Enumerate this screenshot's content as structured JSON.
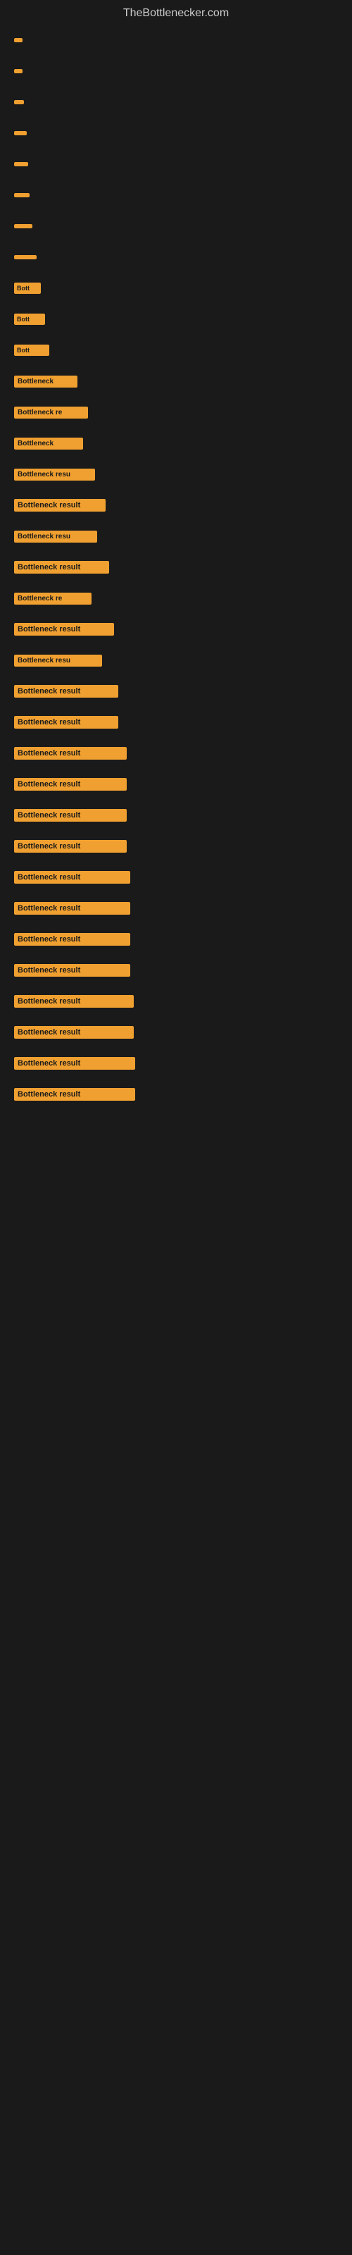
{
  "header": {
    "title": "TheBottlenecker.com"
  },
  "chart": {
    "accent_color": "#f0a030",
    "background": "#1a1a1a",
    "bars": [
      {
        "id": 1,
        "label": "",
        "width": 8
      },
      {
        "id": 2,
        "label": "",
        "width": 12
      },
      {
        "id": 3,
        "label": "",
        "width": 14
      },
      {
        "id": 4,
        "label": "",
        "width": 18
      },
      {
        "id": 5,
        "label": "",
        "width": 20
      },
      {
        "id": 6,
        "label": "",
        "width": 22
      },
      {
        "id": 7,
        "label": "",
        "width": 26
      },
      {
        "id": 8,
        "label": "",
        "width": 32
      },
      {
        "id": 9,
        "label": "Bott",
        "width": 38
      },
      {
        "id": 10,
        "label": "Bott",
        "width": 44
      },
      {
        "id": 11,
        "label": "Bott",
        "width": 50
      },
      {
        "id": 12,
        "label": "Bottleneck",
        "width": 90
      },
      {
        "id": 13,
        "label": "Bottleneck re",
        "width": 105
      },
      {
        "id": 14,
        "label": "Bottleneck",
        "width": 98
      },
      {
        "id": 15,
        "label": "Bottleneck resu",
        "width": 115
      },
      {
        "id": 16,
        "label": "Bottleneck result",
        "width": 130
      },
      {
        "id": 17,
        "label": "Bottleneck resu",
        "width": 118
      },
      {
        "id": 18,
        "label": "Bottleneck result",
        "width": 135
      },
      {
        "id": 19,
        "label": "Bottleneck re",
        "width": 110
      },
      {
        "id": 20,
        "label": "Bottleneck result",
        "width": 142
      },
      {
        "id": 21,
        "label": "Bottleneck resu",
        "width": 125
      },
      {
        "id": 22,
        "label": "Bottleneck result",
        "width": 148
      },
      {
        "id": 23,
        "label": "Bottleneck result",
        "width": 148
      },
      {
        "id": 24,
        "label": "Bottleneck result",
        "width": 160
      },
      {
        "id": 25,
        "label": "Bottleneck result",
        "width": 160
      },
      {
        "id": 26,
        "label": "Bottleneck result",
        "width": 160
      },
      {
        "id": 27,
        "label": "Bottleneck result",
        "width": 160
      },
      {
        "id": 28,
        "label": "Bottleneck result",
        "width": 165
      },
      {
        "id": 29,
        "label": "Bottleneck result",
        "width": 165
      },
      {
        "id": 30,
        "label": "Bottleneck result",
        "width": 165
      },
      {
        "id": 31,
        "label": "Bottleneck result",
        "width": 165
      },
      {
        "id": 32,
        "label": "Bottleneck result",
        "width": 170
      },
      {
        "id": 33,
        "label": "Bottleneck result",
        "width": 170
      },
      {
        "id": 34,
        "label": "Bottleneck result",
        "width": 172
      },
      {
        "id": 35,
        "label": "Bottleneck result",
        "width": 172
      }
    ]
  }
}
